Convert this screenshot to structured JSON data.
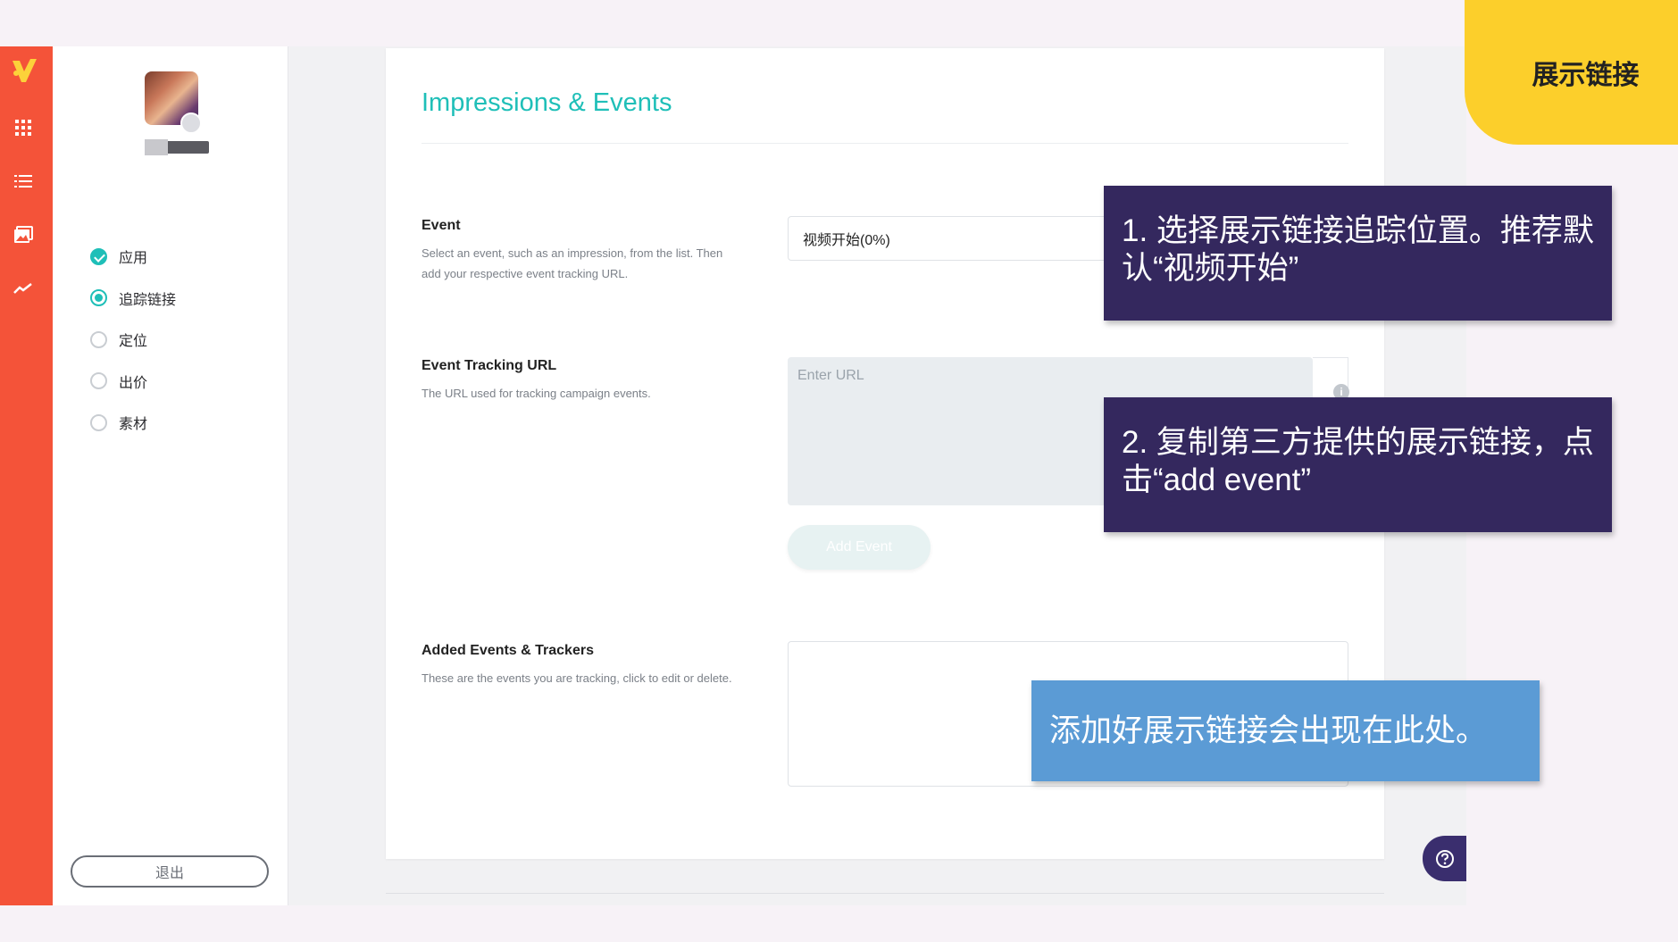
{
  "rail": {
    "icons": [
      "logo-icon",
      "grid-icon",
      "list-icon",
      "image-icon",
      "trend-icon"
    ]
  },
  "sidebar": {
    "steps": [
      {
        "label": "应用",
        "state": "done"
      },
      {
        "label": "追踪链接",
        "state": "active"
      },
      {
        "label": "定位",
        "state": "todo"
      },
      {
        "label": "出价",
        "state": "todo"
      },
      {
        "label": "素材",
        "state": "todo"
      }
    ],
    "logout_label": "退出"
  },
  "card": {
    "title": "Impressions & Events",
    "event": {
      "label": "Event",
      "help": "Select an event, such as an impression, from the list. Then add your respective event tracking URL.",
      "selected": "视频开始(0%)"
    },
    "tracking_url": {
      "label": "Event Tracking URL",
      "help": "The URL used for tracking campaign events.",
      "placeholder": "Enter URL"
    },
    "add_event_label": "Add Event",
    "added": {
      "label": "Added Events & Trackers",
      "help": "These are the events you are tracking, click to edit or delete."
    }
  },
  "overlay": {
    "corner_title": "展示链接",
    "note1": "1. 选择展示链接追踪位置。推荐默认“视频开始”",
    "note2": "2. 复制第三方提供的展示链接，点击“add event”",
    "note3": "添加好展示链接会出现在此处。"
  },
  "colors": {
    "accent": "#1fbfb8",
    "rail": "#f45339",
    "note_purple": "#34285e",
    "note_blue": "#5b9bd5",
    "corner": "#fccf2b"
  }
}
